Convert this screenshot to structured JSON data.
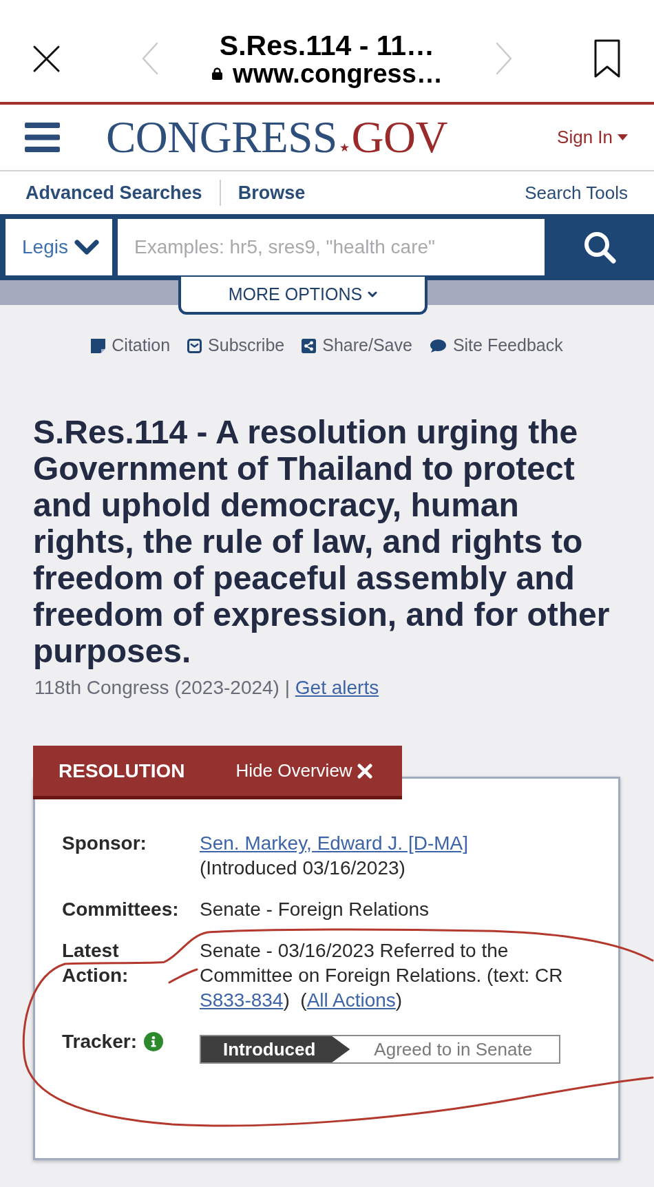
{
  "browser_bar": {
    "title": "S.Res.114 - 11…",
    "url": "www.congress…",
    "back": {
      "disabled": true
    },
    "forward": {
      "disabled": true
    }
  },
  "header": {
    "logo": [
      "CONGRESS",
      "GOV"
    ],
    "sign_in": "Sign In"
  },
  "nav": {
    "links": [
      "Advanced Searches",
      "Browse"
    ],
    "search_tools": "Search Tools"
  },
  "search": {
    "scope": "Legis",
    "placeholder": "Examples: hr5, sres9, \"health care\"",
    "more_options": "MORE OPTIONS"
  },
  "page_actions": [
    "Citation",
    "Subscribe",
    "Share/Save",
    "Site Feedback"
  ],
  "bill": {
    "title": "S.Res.114 - A resolution urging the Government of Thailand to protect and uphold democracy, human rights, the rule of law, and rights to freedom of peaceful assembly and freedom of expression, and for other purposes.",
    "congress": "118th Congress (2023-2024) |",
    "alerts_link": "Get alerts"
  },
  "overview": {
    "type": "RESOLUTION",
    "hide_button": "Hide Overview",
    "rows": [
      {
        "kind": "sponsor",
        "label": "Sponsor:",
        "link": "Sen. Markey, Edward J. [D-MA]",
        "note": "(Introduced 03/16/2023)"
      },
      {
        "kind": "text",
        "label": "Committees:",
        "value": "Senate - Foreign Relations"
      },
      {
        "kind": "action",
        "label": "Latest Action:",
        "parts": [
          {
            "kind": "text",
            "text": "Senate - 03/16/2023 Referred to the Committee on Foreign Relations. (text: CR "
          },
          {
            "kind": "link",
            "text": "S833-834"
          },
          {
            "kind": "text",
            "text": ")  ("
          },
          {
            "kind": "link",
            "text": "All Actions"
          },
          {
            "kind": "text",
            "text": ")"
          }
        ]
      },
      {
        "kind": "tracker",
        "label": "Tracker:",
        "steps": [
          {
            "label": "Introduced",
            "selected": true
          },
          {
            "label": "Agreed to in Senate",
            "selected": false
          }
        ]
      }
    ]
  }
}
